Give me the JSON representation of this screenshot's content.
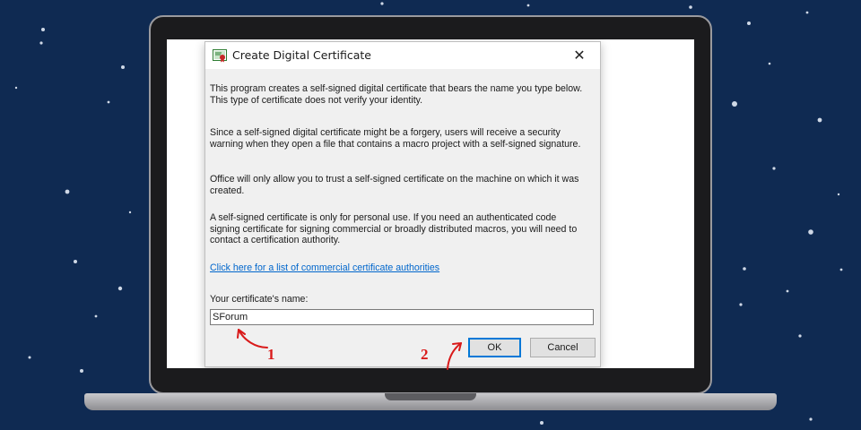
{
  "dialog": {
    "title": "Create Digital Certificate",
    "close_glyph": "✕",
    "paragraphs": [
      "This program creates a self-signed digital certificate that bears the name you type below. This type of certificate does not verify your identity.",
      "Since a self-signed digital certificate might be a forgery, users will receive a security warning when they open a file that contains a macro project with a self-signed signature.",
      "Office will only allow you to trust a self-signed certificate on the machine on which it was created.",
      "A self-signed certificate is only for personal use. If you need an authenticated code signing certificate for signing commercial or broadly distributed macros, you will need to contact a certification authority."
    ],
    "link_text": "Click here for a list of commercial certificate authorities",
    "name_label": "Your certificate's name:",
    "name_value": "SForum",
    "ok_label": "OK",
    "cancel_label": "Cancel"
  },
  "annotations": {
    "step1": "1",
    "step2": "2",
    "color": "#d91a1a"
  },
  "icons": {
    "title": "certificate-icon",
    "close": "close-icon"
  }
}
